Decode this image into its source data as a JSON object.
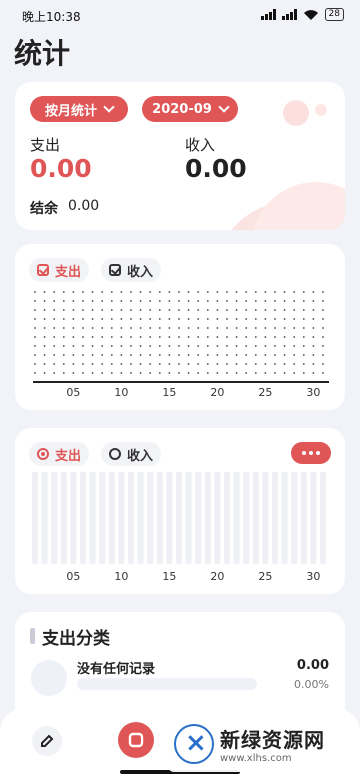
{
  "status_bar": {
    "time": "晚上10:38",
    "battery": "28"
  },
  "page_title": "统计",
  "summary": {
    "period_type": "按月统计",
    "period_value": "2020-09",
    "expense_label": "支出",
    "expense_value": "0.00",
    "income_label": "收入",
    "income_value": "0.00",
    "balance_label": "结余",
    "balance_value": "0.00"
  },
  "line_chart": {
    "legend_expense": "支出",
    "legend_income": "收入",
    "x_ticks": [
      "05",
      "10",
      "15",
      "20",
      "25",
      "30"
    ]
  },
  "bar_chart": {
    "legend_expense": "支出",
    "legend_income": "收入",
    "x_ticks": [
      "05",
      "10",
      "15",
      "20",
      "25",
      "30"
    ]
  },
  "categories": {
    "title": "支出分类",
    "empty_text": "没有任何记录",
    "amount": "0.00",
    "percent": "0.00%"
  },
  "watermark": {
    "name": "新绿资源网",
    "url": "www.xlhs.com"
  },
  "colors": {
    "accent": "#e05555",
    "background": "#f1f3f9"
  },
  "icons": {
    "tab_left": "edit-icon",
    "tab_center": "stats-icon",
    "watermark_logo": "xlhs-logo"
  }
}
